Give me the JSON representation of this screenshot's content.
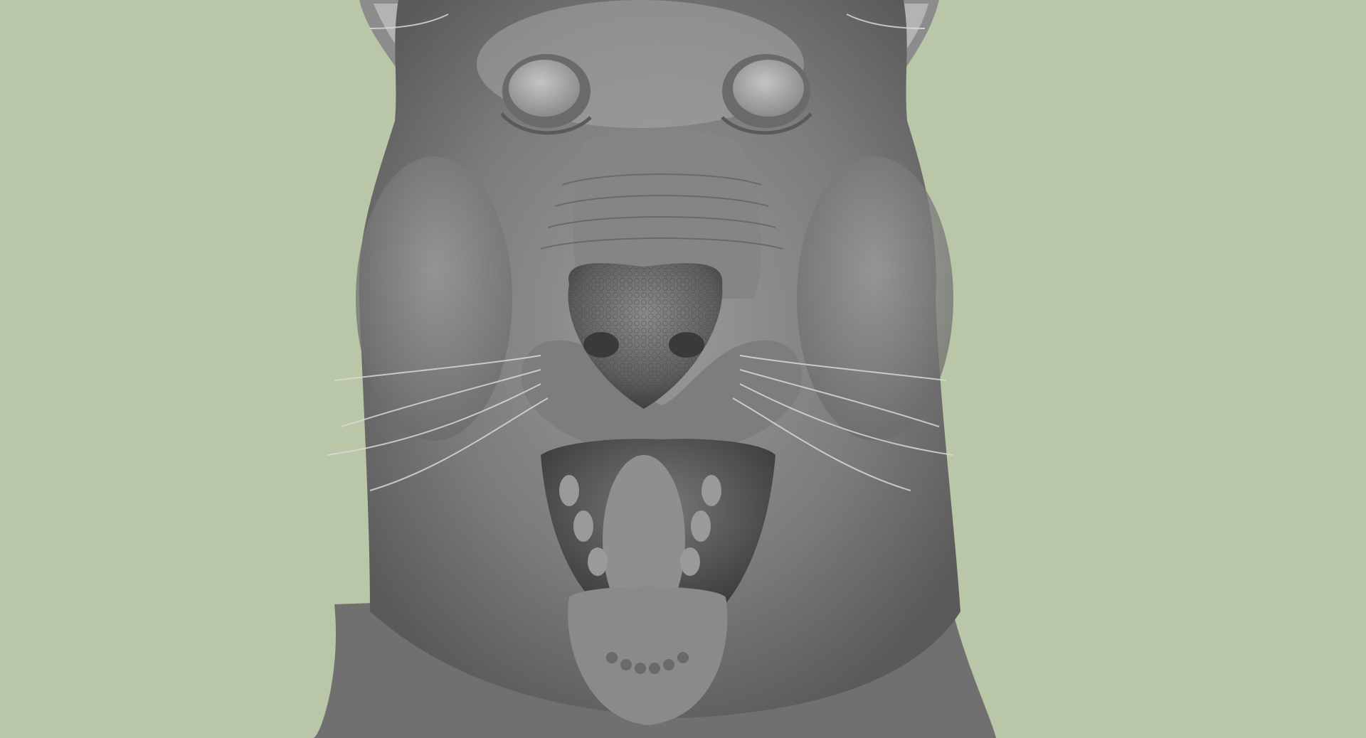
{
  "scene": {
    "subject": "sculpted-dog-head",
    "view": "front",
    "colors": {
      "background": "#b9c6a7",
      "clay_light": "#a5a5a5",
      "clay_mid": "#7f7f7f",
      "clay_dark": "#555555",
      "clay_deep": "#3a3a3a",
      "whisker": "#d8d8d8"
    }
  }
}
